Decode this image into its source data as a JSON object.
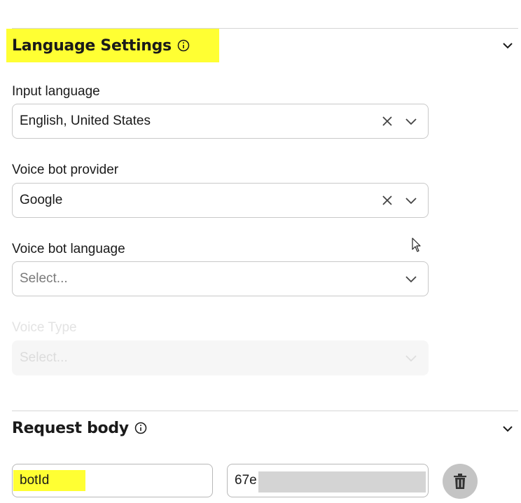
{
  "language_settings": {
    "title": "Language Settings",
    "fields": {
      "input_language": {
        "label": "Input language",
        "value": "English, United States"
      },
      "voice_bot_provider": {
        "label": "Voice bot provider",
        "value": "Google"
      },
      "voice_bot_language": {
        "label": "Voice bot language",
        "placeholder": "Select..."
      },
      "voice_type": {
        "label": "Voice Type",
        "placeholder": "Select...",
        "disabled": true
      }
    }
  },
  "request_body": {
    "title": "Request body",
    "rows": [
      {
        "key": "botId",
        "value": "67e"
      }
    ]
  },
  "icons": [
    "info-icon",
    "chevron-down-icon",
    "clear-icon",
    "trash-icon",
    "mouse-cursor-icon"
  ],
  "colors": {
    "highlight": "#ffff33",
    "border": "#c9c9c9",
    "disabled_bg": "#f6f6f6",
    "delete_button": "#c4c4c4"
  }
}
